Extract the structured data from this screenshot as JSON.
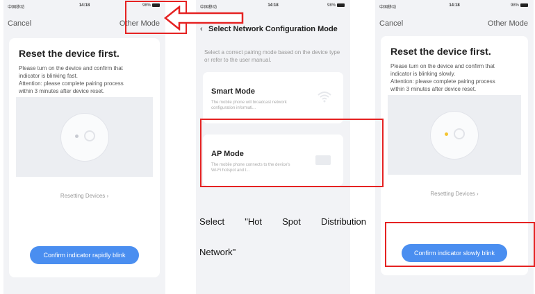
{
  "status_bar": {
    "carrier": "中国移动",
    "time": "14:18",
    "battery": "98%"
  },
  "left_screen": {
    "cancel": "Cancel",
    "other_mode": "Other Mode",
    "title": "Reset the device first.",
    "desc_lines": [
      "Please turn on the device and confirm that",
      "indicator is blinking fast.",
      "Attention: please complete pairing process",
      "within 3 minutes after device reset."
    ],
    "resetting": "Resetting Devices ›",
    "confirm": "Confirm indicator rapidly blink"
  },
  "middle_screen": {
    "back": "‹",
    "title": "Select Network Configuration Mode",
    "hint": "Select a correct pairing mode based on the device type or refer to the user manual.",
    "smart_mode": {
      "title": "Smart Mode",
      "desc": "The mobile phone will broadcast network configuration informati..."
    },
    "ap_mode": {
      "title": "AP Mode",
      "desc": "The mobile phone connects to the device's Wi-Fi hotspot and t..."
    }
  },
  "caption": {
    "line1_words": [
      "Select",
      "\"Hot",
      "Spot",
      "Distribution"
    ],
    "line2": "Network\""
  },
  "right_screen": {
    "cancel": "Cancel",
    "other_mode": "Other Mode",
    "title": "Reset the device first.",
    "desc_lines": [
      "Please turn on the device and confirm that",
      "indicator is blinking slowly.",
      "Attention: please complete pairing process",
      "within 3 minutes after device reset."
    ],
    "resetting": "Resetting Devices ›",
    "confirm": "Confirm indicator slowly blink"
  },
  "colors": {
    "highlight": "#e52222",
    "button": "#4a8ef0",
    "indicator_slow": "#f4c430"
  }
}
